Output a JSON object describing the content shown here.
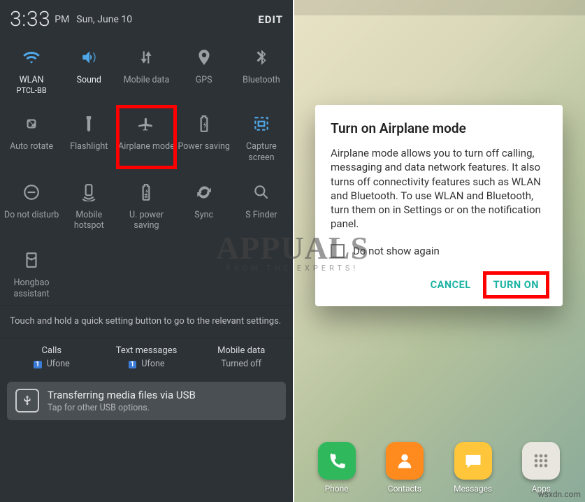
{
  "status": {
    "time": "3:33",
    "ampm": "PM",
    "date": "Sun, June 10",
    "edit": "EDIT"
  },
  "tiles": [
    {
      "name": "wlan-tile",
      "icon": "wifi-icon",
      "label": "WLAN",
      "sub": "PTCL-BB",
      "state": "on"
    },
    {
      "name": "sound-tile",
      "icon": "sound-icon",
      "label": "Sound",
      "sub": "",
      "state": "on"
    },
    {
      "name": "mobiledata-tile",
      "icon": "mobile-data-icon",
      "label": "Mobile data",
      "sub": "",
      "state": "off"
    },
    {
      "name": "gps-tile",
      "icon": "gps-icon",
      "label": "GPS",
      "sub": "",
      "state": "off"
    },
    {
      "name": "bluetooth-tile",
      "icon": "bluetooth-icon",
      "label": "Bluetooth",
      "sub": "",
      "state": "off"
    },
    {
      "name": "autorotate-tile",
      "icon": "rotate-icon",
      "label": "Auto rotate",
      "sub": "",
      "state": "off"
    },
    {
      "name": "flashlight-tile",
      "icon": "flashlight-icon",
      "label": "Flashlight",
      "sub": "",
      "state": "off"
    },
    {
      "name": "airplane-tile",
      "icon": "airplane-icon",
      "label": "Airplane mode",
      "sub": "",
      "state": "off",
      "highlight": true
    },
    {
      "name": "powersaving-tile",
      "icon": "battery-icon",
      "label": "Power saving",
      "sub": "",
      "state": "off"
    },
    {
      "name": "capture-tile",
      "icon": "capture-icon",
      "label": "Capture screen",
      "sub": "",
      "state": "blueframe"
    },
    {
      "name": "dnd-tile",
      "icon": "dnd-icon",
      "label": "Do not disturb",
      "sub": "",
      "state": "off"
    },
    {
      "name": "hotspot-tile",
      "icon": "hotspot-icon",
      "label": "Mobile hotspot",
      "sub": "",
      "state": "off"
    },
    {
      "name": "upowersaving-tile",
      "icon": "ubattery-icon",
      "label": "U. power saving",
      "sub": "",
      "state": "off"
    },
    {
      "name": "sync-tile",
      "icon": "sync-icon",
      "label": "Sync",
      "sub": "",
      "state": "off"
    },
    {
      "name": "sfinder-tile",
      "icon": "search-icon",
      "label": "S Finder",
      "sub": "",
      "state": "off"
    },
    {
      "name": "hongbao-tile",
      "icon": "hongbao-icon",
      "label": "Hongbao assistant",
      "sub": "",
      "state": "off"
    }
  ],
  "hint": "Touch and hold a quick setting button to go to the relevant settings.",
  "summary": {
    "calls": {
      "title": "Calls",
      "badge": "1",
      "carrier": "Ufone"
    },
    "texts": {
      "title": "Text messages",
      "badge": "1",
      "carrier": "Ufone"
    },
    "mdata": {
      "title": "Mobile data",
      "status": "Turned off"
    }
  },
  "usb": {
    "title": "Transferring media files via USB",
    "sub": "Tap for other USB options."
  },
  "dialog": {
    "title": "Turn on Airplane mode",
    "body": "Airplane mode allows you to turn off calling, messaging and data network features. It also turns off connectivity features such as WLAN and Bluetooth. To use WLAN and Bluetooth, turn them on in Settings or on the notification panel.",
    "checkbox_label": "Do not show again",
    "cancel": "CANCEL",
    "confirm": "TURN ON"
  },
  "dock": [
    {
      "name": "phone-app",
      "label": "Phone",
      "cls": "phone",
      "icon": "phone-icon"
    },
    {
      "name": "contacts-app",
      "label": "Contacts",
      "cls": "contacts",
      "icon": "contacts-icon"
    },
    {
      "name": "messages-app",
      "label": "Messages",
      "cls": "msg",
      "icon": "messages-icon"
    },
    {
      "name": "apps-app",
      "label": "Apps",
      "cls": "apps",
      "icon": "apps-icon"
    }
  ],
  "watermark": {
    "main": "APPUALS",
    "sub": "FROM THE EXPERTS!",
    "site": "wsxdn.com"
  }
}
